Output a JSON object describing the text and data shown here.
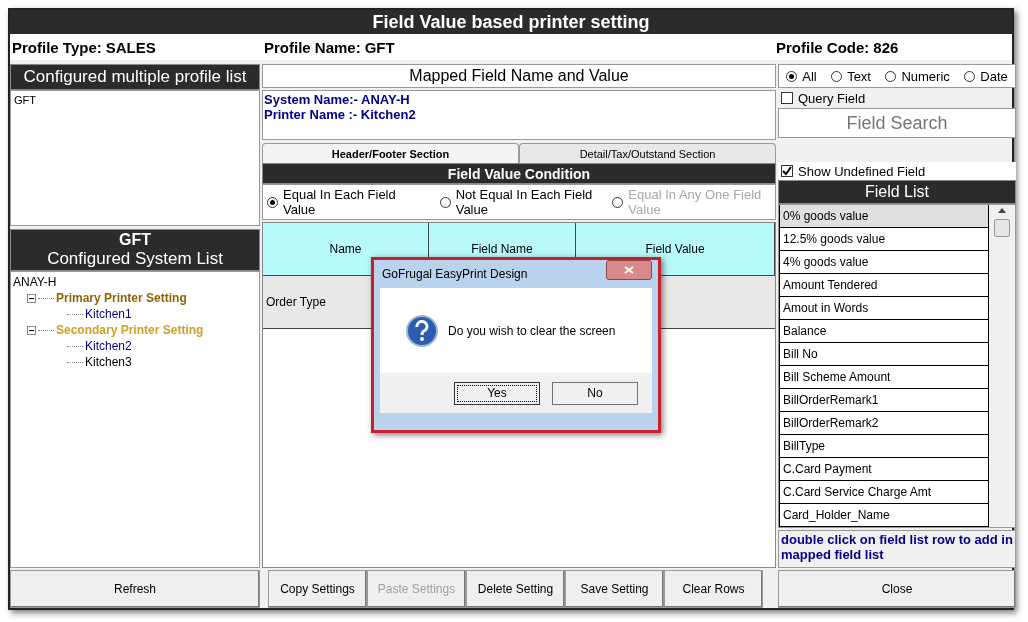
{
  "window": {
    "title": "Field Value based printer setting"
  },
  "profile": {
    "type_label": "Profile Type:",
    "type_value": "SALES",
    "name_label": "Profile Name:",
    "name_value": "GFT",
    "code_label": "Profile Code:",
    "code_value": "826"
  },
  "profile_list": {
    "title": "Configured multiple profile list",
    "items": [
      {
        "label": "GFT",
        "selected": false
      }
    ]
  },
  "system_list": {
    "title": "GFT",
    "subtitle": "Configured System List",
    "tree": [
      {
        "label": "ANAY-H",
        "color": "#000000",
        "children": [
          {
            "label": "Primary Printer Setting",
            "color": "#8b6508",
            "expanded": true,
            "children": [
              {
                "label": "Kitchen1",
                "color": "#000080"
              }
            ]
          },
          {
            "label": "Secondary Printer Setting",
            "color": "#c9a227",
            "expanded": true,
            "children": [
              {
                "label": "Kitchen2",
                "color": "#000080"
              },
              {
                "label": "Kitchen3",
                "color": "#000000"
              }
            ]
          }
        ]
      }
    ]
  },
  "mapped": {
    "title": "Mapped Field Name and Value",
    "lines": [
      "System Name:- ANAY-H",
      "Printer Name :- Kitchen2"
    ]
  },
  "tabs": [
    {
      "label": "Header/Footer Section",
      "selected": true
    },
    {
      "label": "Detail/Tax/Outstand Section",
      "selected": false
    }
  ],
  "condition": {
    "title": "Field Value Condition",
    "options": [
      {
        "label": "Equal In Each Field Value",
        "selected": true,
        "disabled": false
      },
      {
        "label": "Not Equal In Each Field Value",
        "selected": false,
        "disabled": false
      },
      {
        "label": "Equal In Any One Field Value",
        "selected": false,
        "disabled": true
      }
    ]
  },
  "table": {
    "columns": [
      "Name",
      "Field Name",
      "Field Value"
    ],
    "rows": [
      [
        "Order Type"
      ]
    ]
  },
  "filter": {
    "options": [
      {
        "label": "All",
        "selected": true
      },
      {
        "label": "Text",
        "selected": false
      },
      {
        "label": "Numeric",
        "selected": false
      },
      {
        "label": "Date",
        "selected": false
      }
    ],
    "query_field": {
      "label": "Query Field",
      "checked": false
    },
    "search": {
      "placeholder": "Field Search"
    },
    "show_undefined": {
      "label": "Show Undefined Field",
      "checked": true
    }
  },
  "field_list": {
    "title": "Field List",
    "items": [
      {
        "label": "0% goods value",
        "selected": true
      },
      {
        "label": "12.5% goods value",
        "selected": false
      },
      {
        "label": "4% goods value",
        "selected": false
      },
      {
        "label": "Amount Tendered",
        "selected": false
      },
      {
        "label": "Amout in Words",
        "selected": false
      },
      {
        "label": "Balance",
        "selected": false
      },
      {
        "label": "Bill No",
        "selected": false
      },
      {
        "label": "Bill Scheme Amount",
        "selected": false
      },
      {
        "label": "BillOrderRemark1",
        "selected": false
      },
      {
        "label": "BillOrderRemark2",
        "selected": false
      },
      {
        "label": "BillType",
        "selected": false
      },
      {
        "label": "C.Card Payment",
        "selected": false
      },
      {
        "label": "C.Card Service Charge Amt",
        "selected": false
      },
      {
        "label": "Card_Holder_Name",
        "selected": false
      }
    ],
    "hint": "double click on field list row to add in mapped field list"
  },
  "buttons": {
    "refresh": {
      "label": "Refresh",
      "disabled": false
    },
    "middle": [
      {
        "label": "Copy Settings",
        "disabled": false
      },
      {
        "label": "Paste Settings",
        "disabled": true
      },
      {
        "label": "Delete Setting",
        "disabled": false
      },
      {
        "label": "Save Setting",
        "disabled": false
      },
      {
        "label": "Clear Rows",
        "disabled": false
      }
    ],
    "close": {
      "label": "Close",
      "disabled": false
    }
  },
  "dialog": {
    "title": "GoFrugal EasyPrint Design",
    "message": "Do you wish to clear the screen",
    "buttons": [
      {
        "label": "Yes",
        "focused": true
      },
      {
        "label": "No",
        "focused": false
      }
    ]
  }
}
